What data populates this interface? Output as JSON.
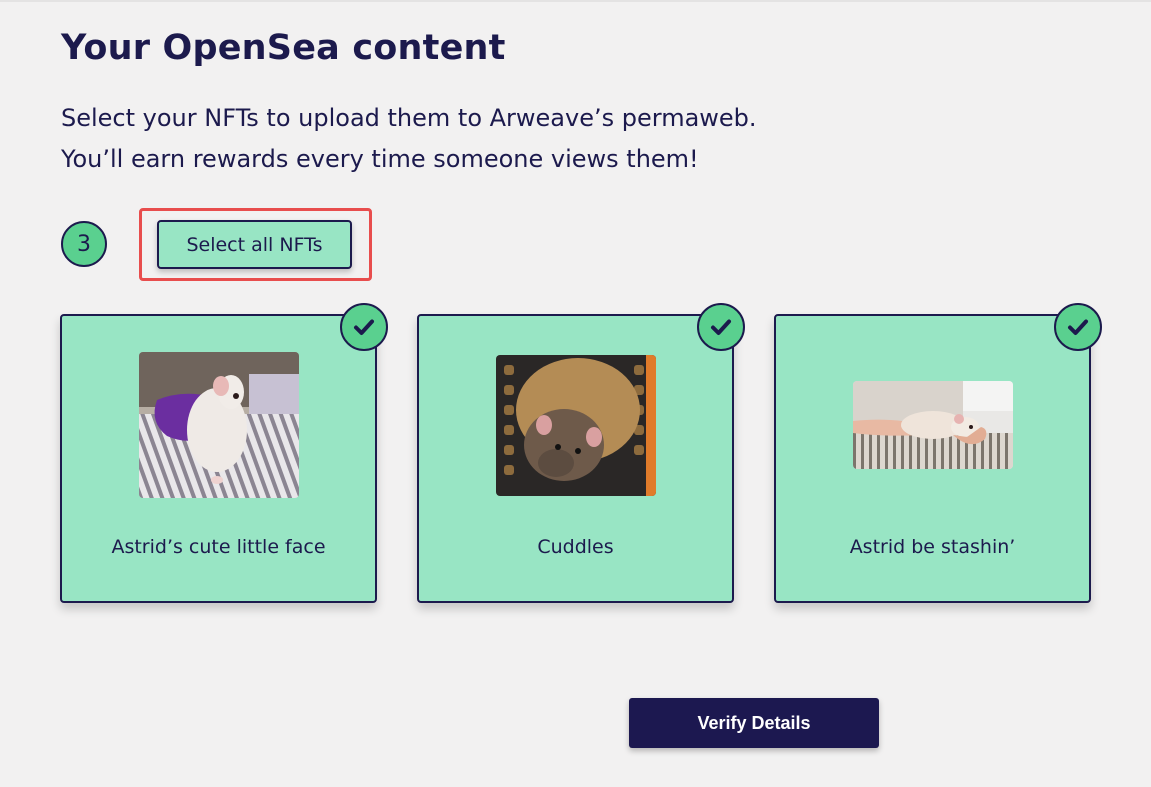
{
  "page": {
    "title": "Your OpenSea content",
    "subtitle_line1": "Select your NFTs to upload them to Arweave’s permaweb.",
    "subtitle_line2": "You’ll earn rewards every time someone views them!"
  },
  "selection": {
    "step_number": "3",
    "select_all_label": "Select all NFTs"
  },
  "nfts": [
    {
      "name": "Astrid’s cute little face",
      "selected": true
    },
    {
      "name": "Cuddles",
      "selected": true
    },
    {
      "name": "Astrid be stashin’",
      "selected": true
    }
  ],
  "actions": {
    "verify_label": "Verify Details"
  },
  "colors": {
    "background": "#f2f1f1",
    "text": "#1c1a4d",
    "card": "#98e5c4",
    "badge": "#5ad08f",
    "highlight": "#e84d4d",
    "primary_button": "#1c1850"
  }
}
